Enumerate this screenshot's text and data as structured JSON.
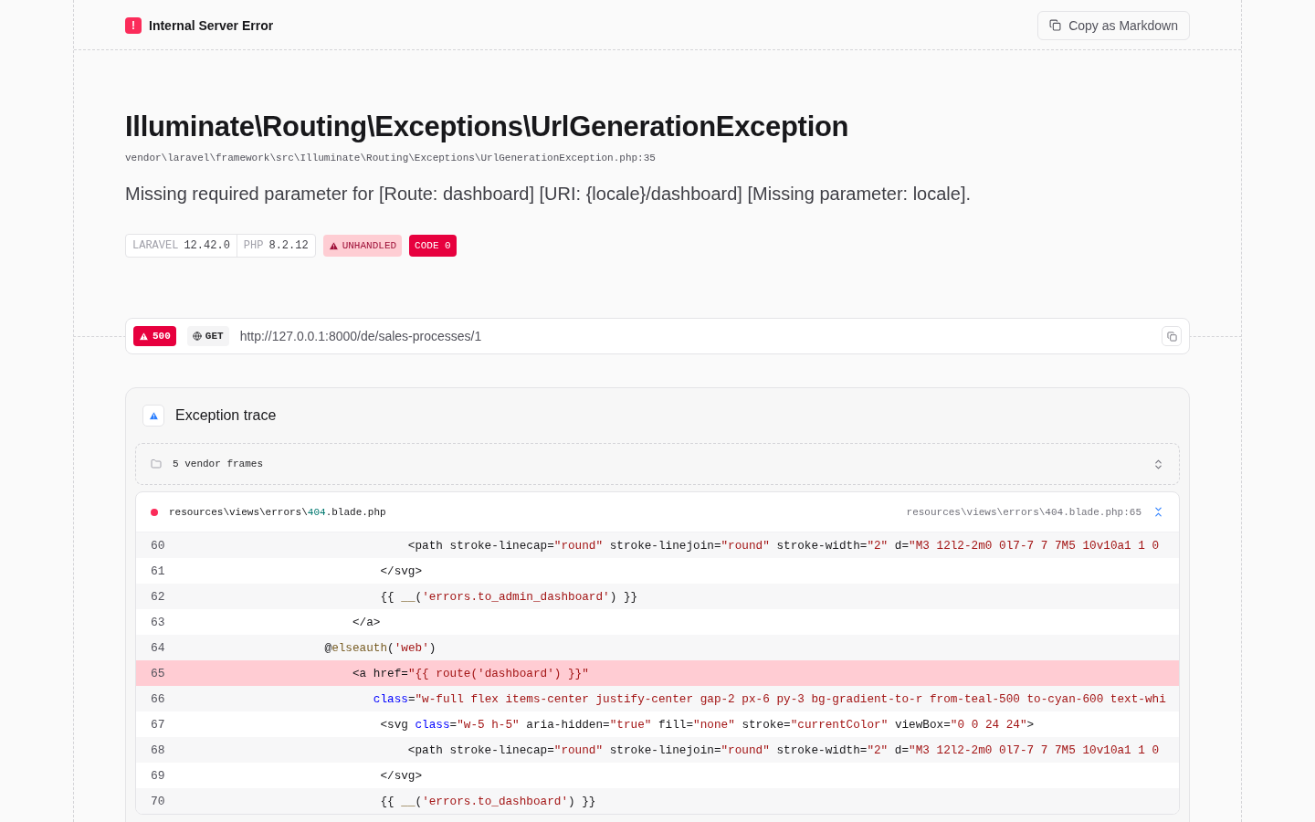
{
  "header": {
    "badge": "!",
    "title": "Internal Server Error",
    "copy_button": "Copy as Markdown"
  },
  "exception": {
    "class": "Illuminate\\Routing\\Exceptions\\UrlGenerationException",
    "file": "vendor\\laravel\\framework\\src\\Illuminate\\Routing\\Exceptions\\UrlGenerationException.php:35",
    "message": "Missing required parameter for [Route: dashboard] [URI: {locale}/dashboard] [Missing parameter: locale]."
  },
  "versions": [
    {
      "label": "LARAVEL",
      "value": "12.42.0"
    },
    {
      "label": "PHP",
      "value": "8.2.12"
    }
  ],
  "tags": [
    {
      "kind": "warning",
      "text": "UNHANDLED"
    },
    {
      "kind": "solid",
      "text": "CODE 0"
    }
  ],
  "request": {
    "status": "500",
    "method": "GET",
    "url": "http://127.0.0.1:8000/de/sales-processes/1"
  },
  "trace": {
    "title": "Exception trace",
    "vendor_frames": "5 vendor frames",
    "vendor_expanded": false,
    "frame": {
      "path": [
        {
          "kind": "plain",
          "text": "resources\\views\\errors\\"
        },
        {
          "kind": "accent",
          "text": "404"
        },
        {
          "kind": "plain",
          "text": ".blade.php"
        }
      ],
      "location": "resources\\views\\errors\\404.blade.php:65",
      "expanded": true,
      "lines": [
        {
          "number": "60",
          "highlighted": false,
          "tokens": [
            {
              "kind": "plain",
              "text": "                                  <path stroke-linecap="
            },
            {
              "kind": "string",
              "text": "\"round\""
            },
            {
              "kind": "plain",
              "text": " stroke-linejoin="
            },
            {
              "kind": "string",
              "text": "\"round\""
            },
            {
              "kind": "plain",
              "text": " stroke-width="
            },
            {
              "kind": "string",
              "text": "\"2\""
            },
            {
              "kind": "plain",
              "text": " d="
            },
            {
              "kind": "string",
              "text": "\"M3 12l2-2m0 0l7-7 7 7M5 10v10a1 1 0"
            }
          ]
        },
        {
          "number": "61",
          "highlighted": false,
          "tokens": [
            {
              "kind": "plain",
              "text": "                              </svg>"
            }
          ]
        },
        {
          "number": "62",
          "highlighted": false,
          "tokens": [
            {
              "kind": "plain",
              "text": "                              {{ "
            },
            {
              "kind": "function",
              "text": "__"
            },
            {
              "kind": "plain",
              "text": "("
            },
            {
              "kind": "string",
              "text": "'errors.to_admin_dashboard'"
            },
            {
              "kind": "plain",
              "text": ") }}"
            }
          ]
        },
        {
          "number": "63",
          "highlighted": false,
          "tokens": [
            {
              "kind": "plain",
              "text": "                          </a>"
            }
          ]
        },
        {
          "number": "64",
          "highlighted": false,
          "tokens": [
            {
              "kind": "plain",
              "text": "                      @"
            },
            {
              "kind": "function",
              "text": "elseauth"
            },
            {
              "kind": "plain",
              "text": "("
            },
            {
              "kind": "string",
              "text": "'web'"
            },
            {
              "kind": "plain",
              "text": ")"
            }
          ]
        },
        {
          "number": "65",
          "highlighted": true,
          "tokens": [
            {
              "kind": "plain",
              "text": "                          <a href="
            },
            {
              "kind": "string",
              "text": "\"{{ route('dashboard') }}\""
            }
          ]
        },
        {
          "number": "66",
          "highlighted": false,
          "tokens": [
            {
              "kind": "attribute",
              "text": "                             class"
            },
            {
              "kind": "plain",
              "text": "="
            },
            {
              "kind": "string",
              "text": "\"w-full flex items-center justify-center gap-2 px-6 py-3 bg-gradient-to-r from-teal-500 to-cyan-600 text-whi"
            }
          ]
        },
        {
          "number": "67",
          "highlighted": false,
          "tokens": [
            {
              "kind": "plain",
              "text": "                              <svg "
            },
            {
              "kind": "attribute",
              "text": "class"
            },
            {
              "kind": "plain",
              "text": "="
            },
            {
              "kind": "string",
              "text": "\"w-5 h-5\""
            },
            {
              "kind": "plain",
              "text": " aria-hidden="
            },
            {
              "kind": "string",
              "text": "\"true\""
            },
            {
              "kind": "plain",
              "text": " fill="
            },
            {
              "kind": "string",
              "text": "\"none\""
            },
            {
              "kind": "plain",
              "text": " stroke="
            },
            {
              "kind": "string",
              "text": "\"currentColor\""
            },
            {
              "kind": "plain",
              "text": " viewBox="
            },
            {
              "kind": "string",
              "text": "\"0 0 24 24\""
            },
            {
              "kind": "plain",
              "text": ">"
            }
          ]
        },
        {
          "number": "68",
          "highlighted": false,
          "tokens": [
            {
              "kind": "plain",
              "text": "                                  <path stroke-linecap="
            },
            {
              "kind": "string",
              "text": "\"round\""
            },
            {
              "kind": "plain",
              "text": " stroke-linejoin="
            },
            {
              "kind": "string",
              "text": "\"round\""
            },
            {
              "kind": "plain",
              "text": " stroke-width="
            },
            {
              "kind": "string",
              "text": "\"2\""
            },
            {
              "kind": "plain",
              "text": " d="
            },
            {
              "kind": "string",
              "text": "\"M3 12l2-2m0 0l7-7 7 7M5 10v10a1 1 0"
            }
          ]
        },
        {
          "number": "69",
          "highlighted": false,
          "tokens": [
            {
              "kind": "plain",
              "text": "                              </svg>"
            }
          ]
        },
        {
          "number": "70",
          "highlighted": false,
          "tokens": [
            {
              "kind": "plain",
              "text": "                              {{ "
            },
            {
              "kind": "function",
              "text": "__"
            },
            {
              "kind": "plain",
              "text": "("
            },
            {
              "kind": "string",
              "text": "'errors.to_dashboard'"
            },
            {
              "kind": "plain",
              "text": ") }}"
            }
          ]
        }
      ]
    }
  }
}
